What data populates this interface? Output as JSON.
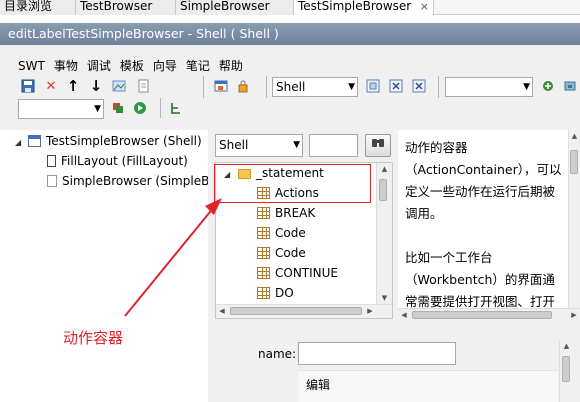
{
  "tabs": [
    "目录浏览",
    "TestBrowser",
    "SimpleBrowser",
    "TestSimpleBrowser"
  ],
  "tab_close_glyph": "×",
  "window_title": "editLabelTestSimpleBrowser - Shell ( Shell )",
  "menu": [
    "SWT",
    "事物",
    "调试",
    "模板",
    "向导",
    "笔记",
    "帮助"
  ],
  "toolbar": {
    "shell_combo": "Shell"
  },
  "tree": [
    {
      "label": "TestSimpleBrowser (Shell)",
      "icon": "shell-window-icon"
    },
    {
      "label": "FillLayout (FillLayout)",
      "icon": "layout-icon"
    },
    {
      "label": "SimpleBrowser (SimpleB",
      "icon": "page-icon"
    }
  ],
  "palette": {
    "type_combo": "Shell",
    "search_value": "",
    "items": [
      "_statement",
      "Actions",
      "BREAK",
      "Code",
      "Code",
      "CONTINUE",
      "DO"
    ]
  },
  "description": [
    "动作的容器",
    "（ActionContainer），可以",
    "定义一些动作在运行后期被",
    "调用。",
    "",
    "比如一个工作台",
    "（Workbentch）的界面通",
    "常需要提供打开视图、打开"
  ],
  "properties": {
    "name_label": "name:",
    "name_value": "",
    "edit_label": "编辑"
  },
  "annotation": "动作容器",
  "colors": {
    "annotation": "#e0232a",
    "titlebar": "#7a8aa3"
  }
}
